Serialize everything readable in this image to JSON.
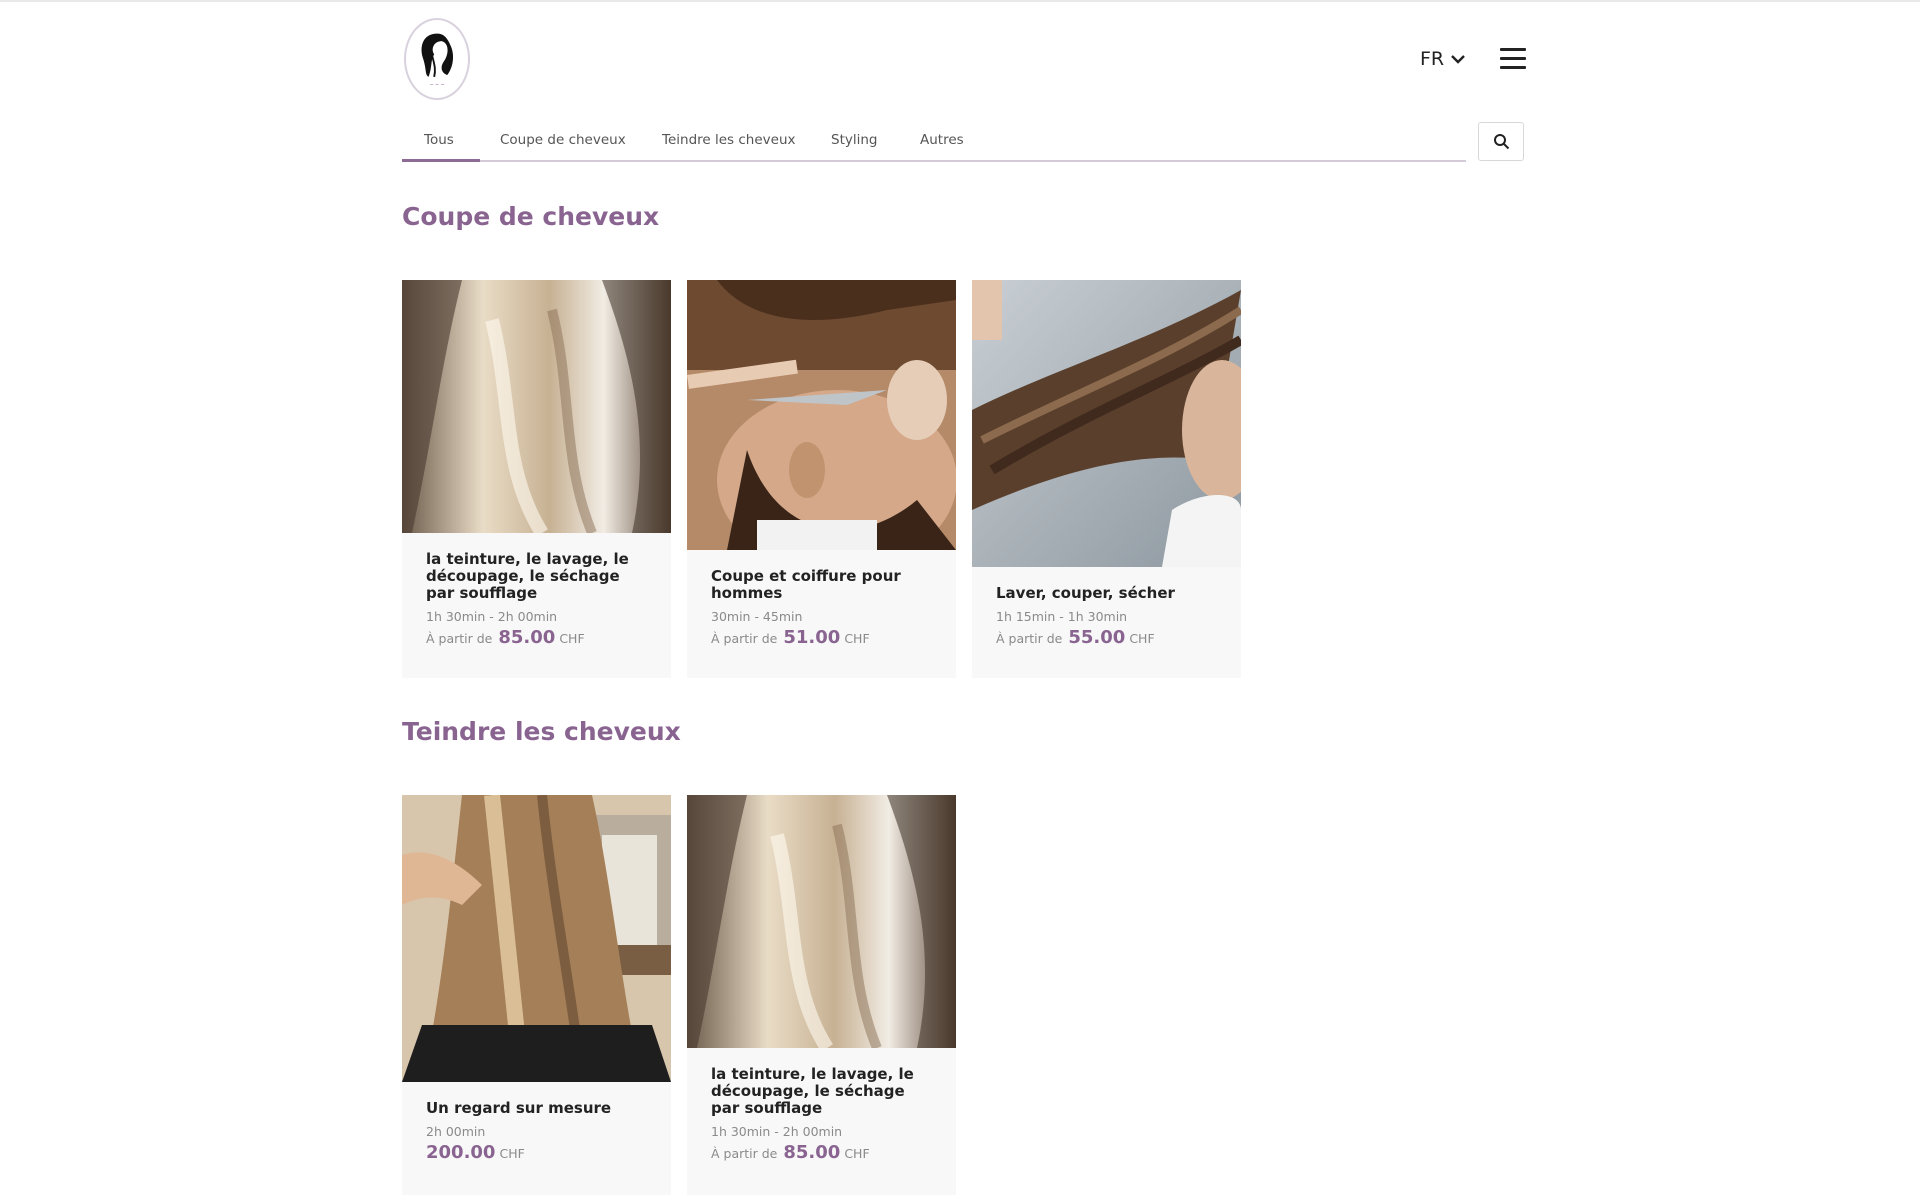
{
  "header": {
    "logo_alt": "Logo",
    "language": "FR"
  },
  "tabs": [
    {
      "label": "Tous",
      "active": true
    },
    {
      "label": "Coupe de cheveux",
      "active": false
    },
    {
      "label": "Teindre les cheveux",
      "active": false
    },
    {
      "label": "Styling",
      "active": false
    },
    {
      "label": "Autres",
      "active": false
    }
  ],
  "sections": [
    {
      "title": "Coupe de cheveux",
      "cards": [
        {
          "title": "la teinture, le lavage, le découpage, le séchage par soufflage",
          "duration": "1h 30min - 2h 00min",
          "from_label": "À partir de",
          "price": "85.00",
          "currency": "CHF",
          "image": "balayage-blonde-hair"
        },
        {
          "title": "Coupe et coiffure pour hommes",
          "duration": "30min - 45min",
          "from_label": "À partir de",
          "price": "51.00",
          "currency": "CHF",
          "image": "men-haircut-scissors"
        },
        {
          "title": "Laver, couper, sécher",
          "duration": "1h 15min - 1h 30min",
          "from_label": "À partir de",
          "price": "55.00",
          "currency": "CHF",
          "image": "long-brown-hair-cut"
        }
      ]
    },
    {
      "title": "Teindre les cheveux",
      "cards": [
        {
          "title": "Un regard sur mesure",
          "duration": "2h 00min",
          "from_label": "",
          "price": "200.00",
          "currency": "CHF",
          "image": "straight-blonde-hair-salon"
        },
        {
          "title": "la teinture, le lavage, le découpage, le séchage par soufflage",
          "duration": "1h 30min - 2h 00min",
          "from_label": "À partir de",
          "price": "85.00",
          "currency": "CHF",
          "image": "balayage-blonde-hair"
        }
      ]
    }
  ],
  "colors": {
    "accent": "#8a6491",
    "card_bg": "#f8f8f8"
  }
}
